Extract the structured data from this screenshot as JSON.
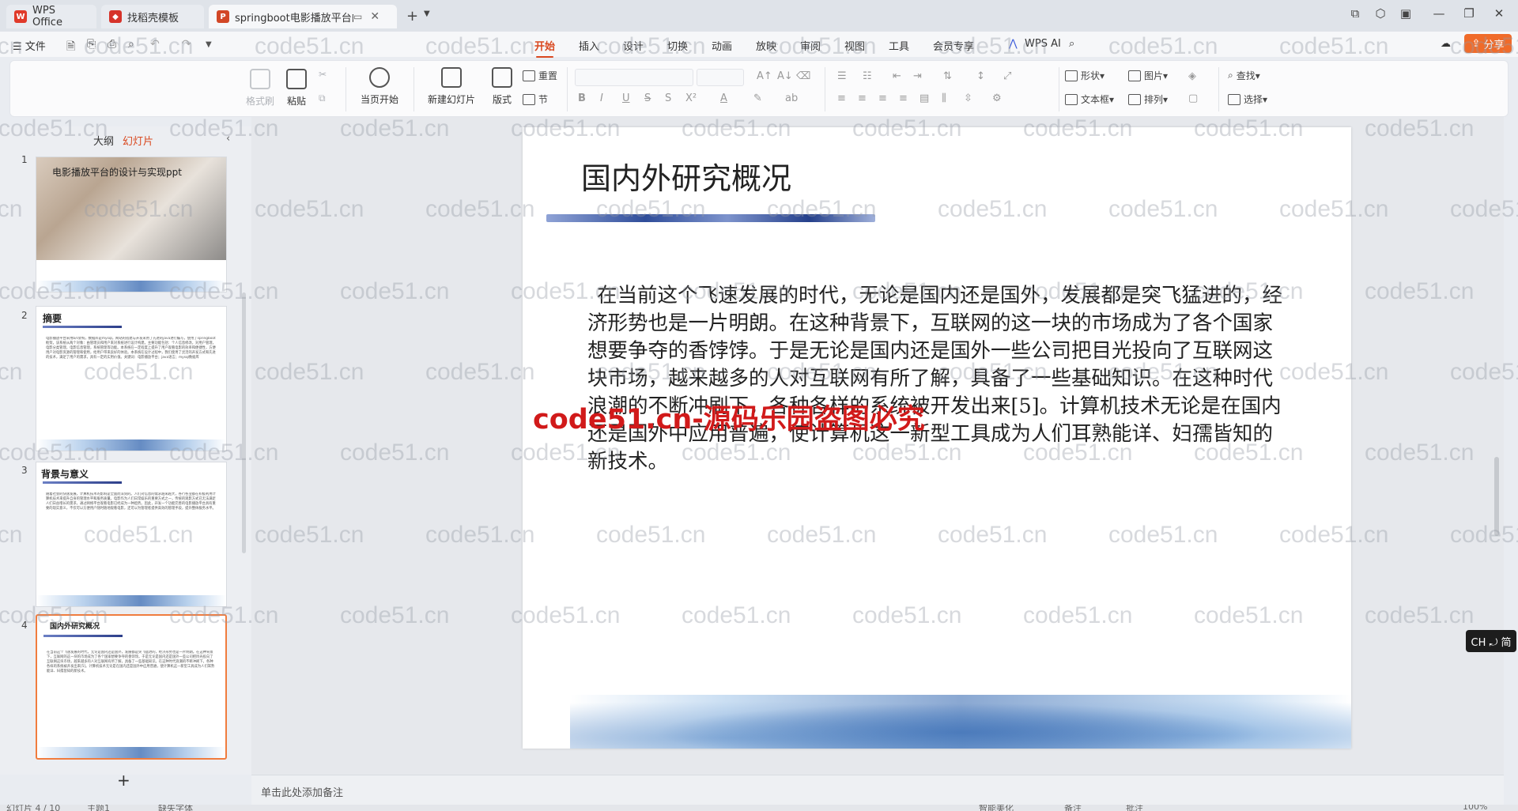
{
  "titlebar": {
    "tabs": [
      {
        "label": "WPS Office",
        "icon": "wps-icon",
        "color": "#e03a2a"
      },
      {
        "label": "找稻壳模板",
        "icon": "docer-icon",
        "color": "#d6332a"
      },
      {
        "label": "springboot电影播放平台的",
        "icon": "ppt-icon",
        "color": "#d24726"
      }
    ],
    "new_tab": "+"
  },
  "menubar": {
    "file": "☰ 文件",
    "tabs": [
      "开始",
      "插入",
      "设计",
      "切换",
      "动画",
      "放映",
      "审阅",
      "视图",
      "工具",
      "会员专享"
    ],
    "active_tab": "开始",
    "wps_ai": "WPS AI",
    "share": "分享"
  },
  "ribbon": {
    "format_painter": "格式刷",
    "paste": "粘贴",
    "start_from_current": "当页开始",
    "new_slide": "新建幻灯片",
    "layout": "版式",
    "reset": "重置",
    "section": "节",
    "shape": "形状",
    "picture": "图片",
    "textbox": "文本框",
    "arrange": "排列",
    "find": "查找",
    "select": "选择",
    "format_buttons": [
      "B",
      "I",
      "U",
      "S",
      "S",
      "X²",
      "A",
      "ab"
    ]
  },
  "leftpanel": {
    "outline_tab": "大纲",
    "slides_tab": "幻灯片",
    "slides": [
      {
        "num": "1",
        "title": "电影播放平台的设计与实现ppt"
      },
      {
        "num": "2",
        "title": "摘要",
        "text": "电影播放平台采用b/s架构，数据库是mysql。网站的搭建与开发采用了先进的java进行编写，使用了springboot框架。该系统从两个对象：由管理员和用户来对系统进行设计构建。主要功能包括：个人信息修改，对用户管理，电影分类管理，电影信息管理，系统管理等功能。本系统在一定程度上提升了用户观看电影的效率和便捷性，方便用户对电影资源的管理和使用，给用户带来良好的体验。本系统在设计过程中，我们使用了灵活的开发方式和先进的技术，满足了用户的需求，具有一定的实用价值。关键词：电影播放平台；java语言；mysql数据库"
      },
      {
        "num": "3",
        "title": "背景与意义",
        "text": "随着社会的快速发展，计算机技术的影响是全面而深刻的。人们对信息的需求越来越大，各行各业都在积极利用计算机技术来提升自身的管理水平和服务质量。电影作为人们日常娱乐的重要方式之一，传统的观影方式已无法满足人们日益增长的需求，通过网络平台观看电影已经成为一种趋势。因此，开发一个功能完善的电影播放平台具有重要的现实意义，不仅可以方便用户随时随地观看电影，还可以为管理者提供高效的管理手段，提升整体服务水平。"
      },
      {
        "num": "4",
        "title": "国内外研究概况",
        "text": "在当前这个飞速发展的时代，无论是国内还是国外，发展都是突飞猛进的，经济形势也是一片明朗。在这种背景下，互联网的这一块的市场成为了各个国家想要争夺的香饽饽。于是无论是国内还是国外一些公司把目光投向了互联网这块市场，越来越多的人对互联网有所了解，具备了一些基础知识。在这种时代浪潮的不断冲刷下，各种各样的系统被开发出来[5]。计算机技术无论是在国内还是国外中应用普遍，使计算机这一新型工具成为人们耳熟能详、妇孺皆知的新技术。"
      }
    ],
    "selected": "4",
    "add": "+"
  },
  "slide": {
    "title": "国内外研究概况",
    "body": "在当前这个飞速发展的时代，无论是国内还是国外，发展都是突飞猛进的，经济形势也是一片明朗。在这种背景下，互联网的这一块的市场成为了各个国家想要争夺的香饽饽。于是无论是国内还是国外一些公司把目光投向了互联网这块市场，越来越多的人对互联网有所了解，具备了一些基础知识。在这种时代浪潮的不断冲刷下，各种各样的系统被开发出来[5]。计算机技术无论是在国内还是国外中应用普遍，使计算机这一新型工具成为人们耳熟能详、妇孺皆知的新技术。"
  },
  "watermark": {
    "text": "code51.cn",
    "red_text": "code51.cn-源码乐园盗图必究"
  },
  "ime": "CH ⤾ 简",
  "notes_placeholder": "单击此处添加备注",
  "statusbar": {
    "slide_info": "幻灯片 4 / 10",
    "theme": "主题1",
    "font_missing": "缺失字体",
    "smart_beautify": "智能美化",
    "notes": "备注",
    "comment": "批注",
    "zoom": "100%"
  },
  "colors": {
    "accent": "#d9481f",
    "share": "#f06b2a",
    "selected_border": "#f07c3e"
  }
}
